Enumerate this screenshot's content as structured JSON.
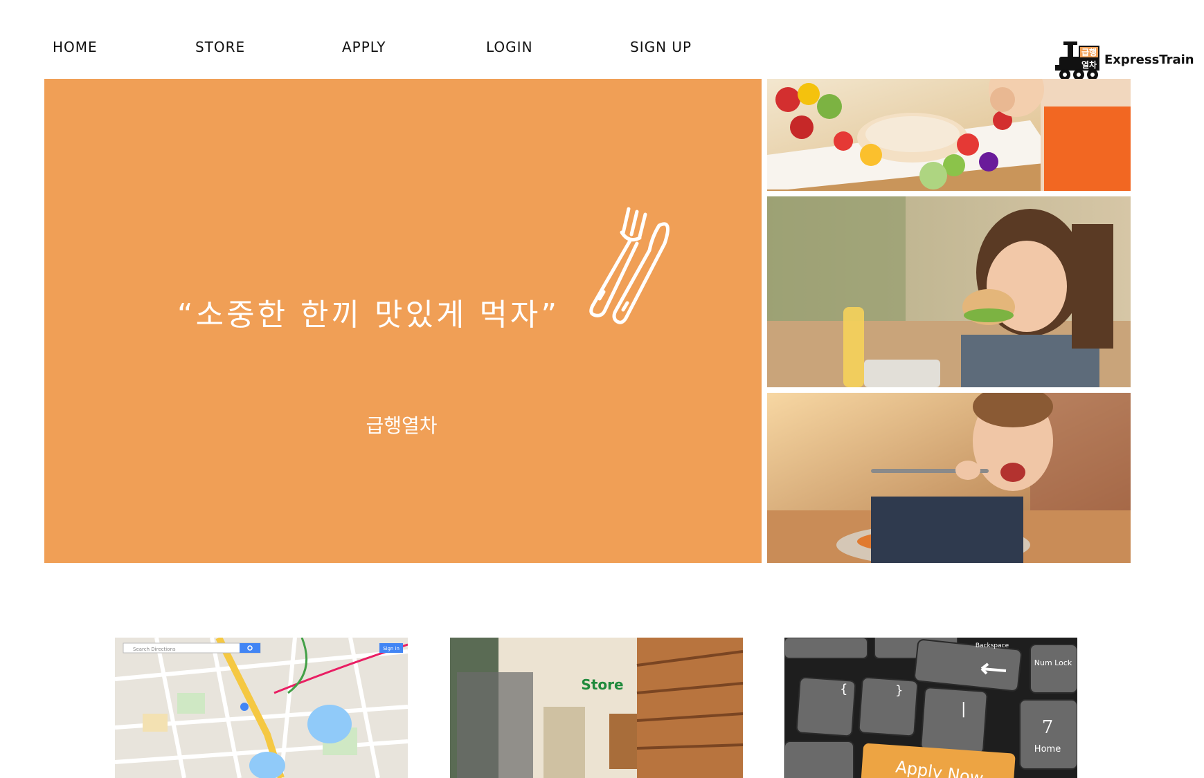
{
  "nav": {
    "items": [
      {
        "label": "HOME"
      },
      {
        "label": "STORE"
      },
      {
        "label": "APPLY"
      },
      {
        "label": "LOGIN"
      },
      {
        "label": "SIGN UP"
      }
    ]
  },
  "logo": {
    "text": "ExpressTrain",
    "badge_top": "급행",
    "badge_bottom": "열차"
  },
  "hero": {
    "quote": "“소중한 한끼 맛있게 먹자”",
    "subtitle": "급행열차",
    "background_color": "#f09f56"
  },
  "photos": [
    {
      "alt": "fruit platter with smiling child"
    },
    {
      "alt": "girl eating a sandwich"
    },
    {
      "alt": "boy eating with a fork"
    }
  ],
  "cards": [
    {
      "alt": "map"
    },
    {
      "alt": "store",
      "sign": "Store"
    },
    {
      "alt": "keyboard apply now",
      "key_number": "7",
      "key_home": "Home",
      "key_numlock": "Num Lock",
      "key_backspace": "Backspace",
      "key_apply": "Apply Now"
    }
  ],
  "map_ui": {
    "search_placeholder": "Search Directions",
    "sign_in": "Sign in"
  }
}
